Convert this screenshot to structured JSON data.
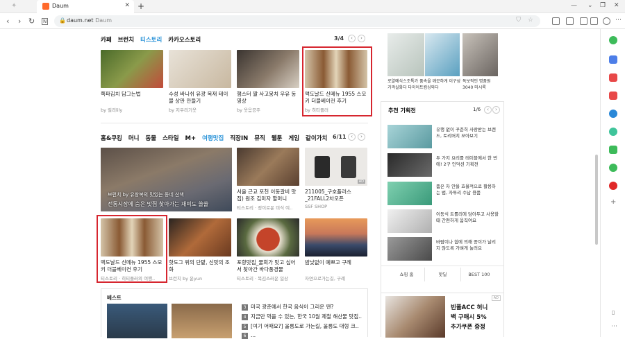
{
  "browser": {
    "tab_title": "Daum",
    "url": "daum.net",
    "url_title": "Daum"
  },
  "section1": {
    "tabs": [
      {
        "label": "카페"
      },
      {
        "label": "브런치"
      },
      {
        "label": "티스토리"
      },
      {
        "label": "카카오스토리"
      }
    ],
    "pager": "3/4",
    "cards": [
      {
        "title": "쪽파김치 담그는법",
        "source": "by 릴리lily",
        "color": "#6a7a3a"
      },
      {
        "title": "수성 바니쉬 유광 목재 테이블 상판 만들기",
        "source": "by 지우리기웃",
        "color": "#d8cfc2"
      },
      {
        "title": "햄스터 짤 사고뭉치 우유 동영상",
        "source": "by 웃음공주",
        "color": "#5a5048"
      },
      {
        "title": "맥도날드 신메뉴 1955 스모키 더블베이컨 후기",
        "source": "by 히티플러",
        "color": "#c59a5e"
      }
    ]
  },
  "section2": {
    "tabs": [
      {
        "label": "홈&쿠킹"
      },
      {
        "label": "머니"
      },
      {
        "label": "동물"
      },
      {
        "label": "스타일"
      },
      {
        "label": "M+"
      },
      {
        "label": "여행맛집"
      },
      {
        "label": "직장IN"
      },
      {
        "label": "뮤직"
      },
      {
        "label": "웹툰"
      },
      {
        "label": "게임"
      },
      {
        "label": "같이가치"
      }
    ],
    "pager": "6/11",
    "big_line1": "브런치 by 유창복의 맛있는 동네 산책",
    "big_line2": "전통시장에 숨은 맛집 찾아가는 재미도 쏠쏠",
    "row1": [
      {
        "title": "서울 근교 포천 이동갈비 맛집) 원조 김미자 할머니",
        "source": "티스토리 · 정이로운 미식 여..",
        "color": "#7a5a45"
      },
      {
        "title": "211005_구호플러스 _21FALL2차오픈",
        "source": "SSF SHOP",
        "color": "#e7e5e2",
        "badge": "AD"
      }
    ],
    "row2": [
      {
        "title": "맥도날드 신메뉴 1955 스모키 더블베이컨 후기",
        "source": "티스토리 · 히티플러의 여행..",
        "color": "#c59a5e"
      },
      {
        "title": "핫도그 위의 단팥, 신맛의 조화",
        "source": "브런치 by 윤yun",
        "color": "#8a4a2a"
      },
      {
        "title": "포항맛집_물회가 맛고 싶어서 찾아간 바다풍경물",
        "source": "티스토리 · 복김스러운 일상",
        "color": "#b2543a"
      },
      {
        "title": "밤낮없이 예쁘고 구례",
        "source": "자연으로가는길, 구례",
        "color": "#5a6a80"
      }
    ]
  },
  "best": {
    "label": "베스트",
    "items": [
      {
        "num": "3",
        "text": "미국 광춘에서 한국 음식이 그리운 땐?"
      },
      {
        "num": "4",
        "text": "지금만 먹을 수 있는, 한국 10월 제철 해산물 맛집.."
      },
      {
        "num": "5",
        "text": "[여기 어때요?] 울릉도로 가는길, 울릉도 대형 크.."
      },
      {
        "num": "6",
        "text": "..."
      }
    ]
  },
  "right_top": {
    "items": [
      {
        "title": "로얄예식스조톡가 품속을 깨끗하게 이구성가격실화다 다이어트컴싱와다",
        "color": "#cfd6cf"
      },
      {
        "title": "독보적인 명품원 3040 미시룩",
        "color": "#9a9490"
      }
    ]
  },
  "recommend": {
    "title": "추천 기획전",
    "pager": "1/6",
    "items": [
      {
        "text": "유행 없이 꾸준히 사랑받는 브랜드, 토리버치 모아보기",
        "color": "#7fb2b8"
      },
      {
        "text": "두 가지 요리를 테이블에서 한 번에! 2구 인덕션 기획전",
        "color": "#3a3a3a"
      },
      {
        "text": "줌은 차 안을 효율적으로 활용하는 법, 자투리 수납 용품",
        "color": "#6fbf9f"
      },
      {
        "text": "이동식 트롤리에 담아두고 사용할 때 간편하게 움직여요",
        "color": "#c8c8c8"
      },
      {
        "text": "바람이나 힘에 의해 종이가 날리지 않도록 가벼게 눌러요",
        "color": "#7a7a7a"
      }
    ],
    "tabs": [
      {
        "label": "쇼핑 홈"
      },
      {
        "label": "핫딜"
      },
      {
        "label": "BEST 100"
      }
    ]
  },
  "ad": {
    "badge": "AD",
    "line1": "빈폴ACC 허니",
    "line2": "백 구매시 5%",
    "line3": "추가쿠폰 증정"
  }
}
